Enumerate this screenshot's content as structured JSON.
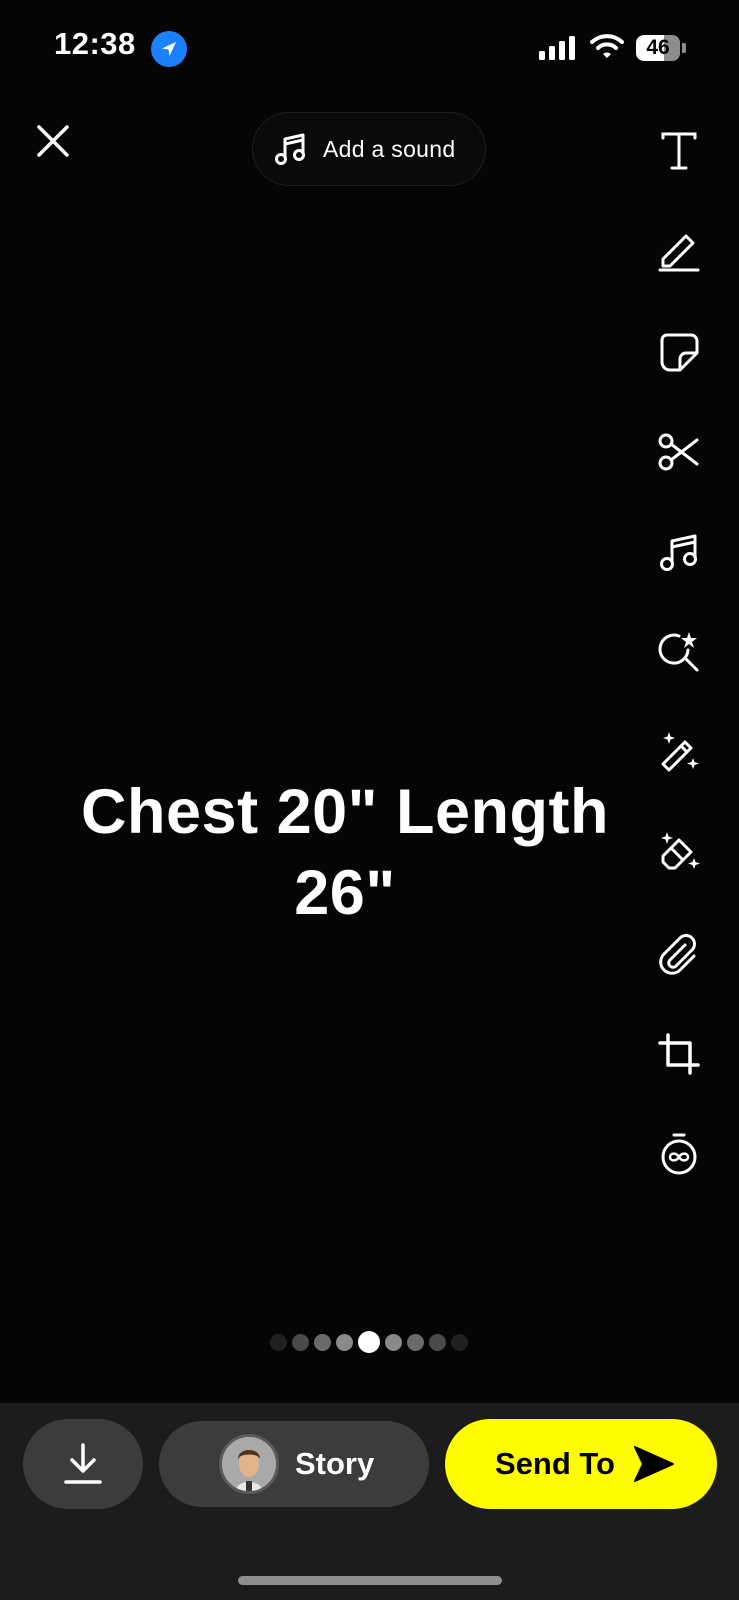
{
  "status_bar": {
    "time": "12:38",
    "battery": "46"
  },
  "top": {
    "sound_label": "Add a sound"
  },
  "toolbar": {
    "icons": [
      "text-icon",
      "pen-icon",
      "sticker-icon",
      "scissors-icon",
      "music-icon",
      "lens-search-icon",
      "magic-wand-icon",
      "magic-eraser-icon",
      "paperclip-icon",
      "crop-icon",
      "timer-icon"
    ]
  },
  "content": {
    "caption": "Chest 20\" Length 26\""
  },
  "pagination": {
    "count": 9,
    "active_index": 4
  },
  "bottom": {
    "story_label": "Story",
    "send_label": "Send To"
  },
  "colors": {
    "accent": "#fffc00",
    "background": "#050505",
    "bar": "#1c1c1c",
    "button": "#3c3c3c"
  }
}
